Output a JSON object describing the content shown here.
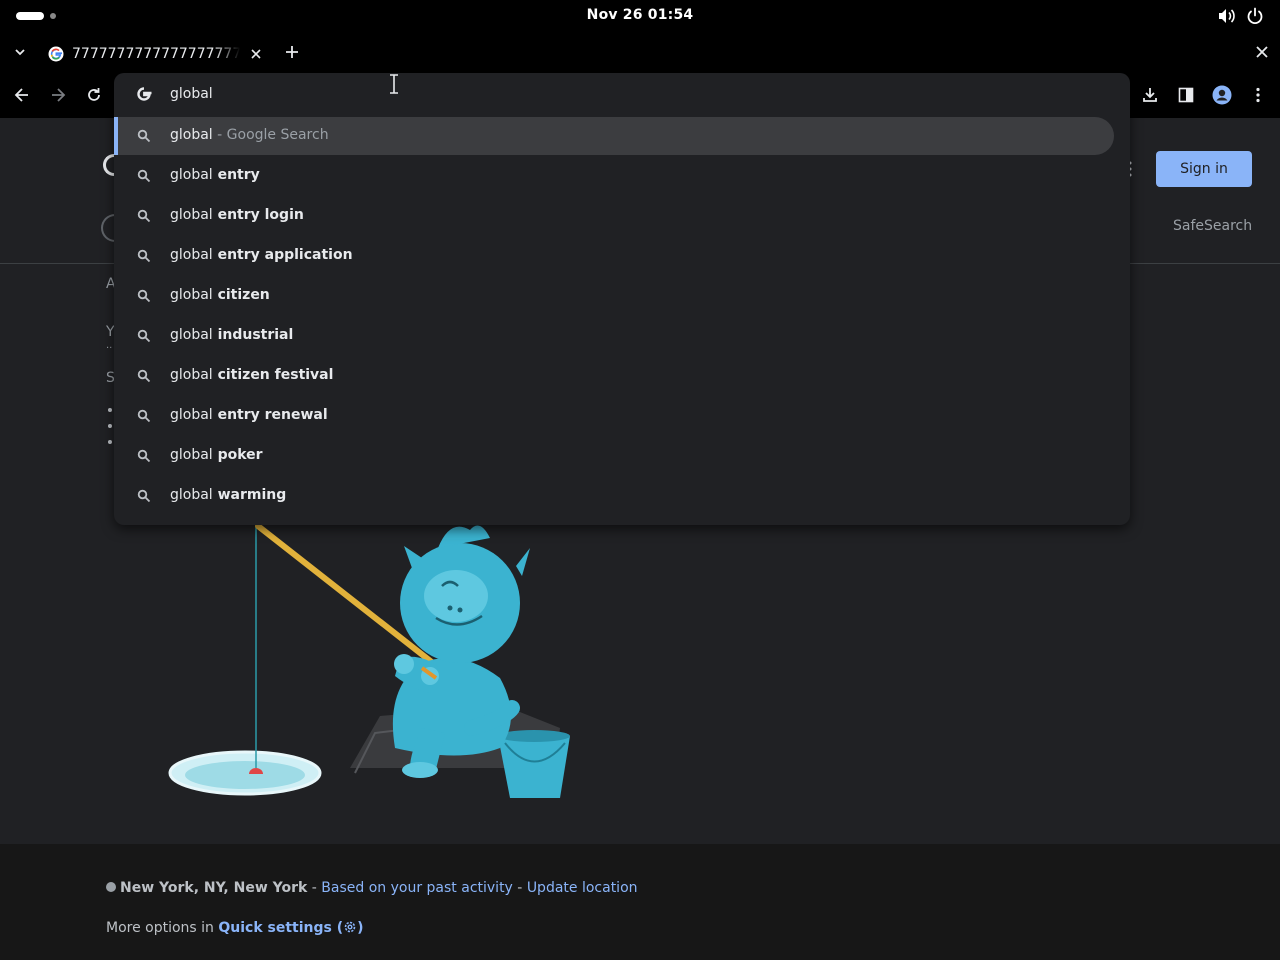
{
  "system": {
    "clock": "Nov 26  01:54",
    "icons": [
      "volume-icon",
      "power-icon"
    ]
  },
  "tab": {
    "title": "77777777777777777777777"
  },
  "omnibox": {
    "value": "global",
    "suggestions": [
      {
        "base": "global",
        "bold": "",
        "sub": " - Google Search"
      },
      {
        "base": "global",
        "bold": " entry",
        "sub": ""
      },
      {
        "base": "global",
        "bold": " entry login",
        "sub": ""
      },
      {
        "base": "global",
        "bold": " entry application",
        "sub": ""
      },
      {
        "base": "global",
        "bold": " citizen",
        "sub": ""
      },
      {
        "base": "global",
        "bold": " industrial",
        "sub": ""
      },
      {
        "base": "global",
        "bold": " citizen festival",
        "sub": ""
      },
      {
        "base": "global",
        "bold": " entry renewal",
        "sub": ""
      },
      {
        "base": "global",
        "bold": " poker",
        "sub": ""
      },
      {
        "base": "global",
        "bold": " warming",
        "sub": ""
      }
    ]
  },
  "page": {
    "signin_label": "Sign in",
    "safesearch_label": "SafeSearch",
    "peek": {
      "a": "A",
      "y": "Y",
      "dots": "..",
      "s": "S"
    },
    "footer": {
      "location": "New York, NY, New York",
      "sep1": " - ",
      "past_activity": "Based on your past activity",
      "sep2": " - ",
      "update_location": "Update location",
      "more_prefix": "More options in ",
      "quick_settings": "Quick settings",
      "gear_open": " (",
      "gear_close": ")"
    }
  },
  "colors": {
    "accent": "#8ab4f8",
    "page_bg": "#202124",
    "chrome_bg": "#000000",
    "selected_row": "#3c3d40",
    "yeti": "#3bb3d0"
  }
}
